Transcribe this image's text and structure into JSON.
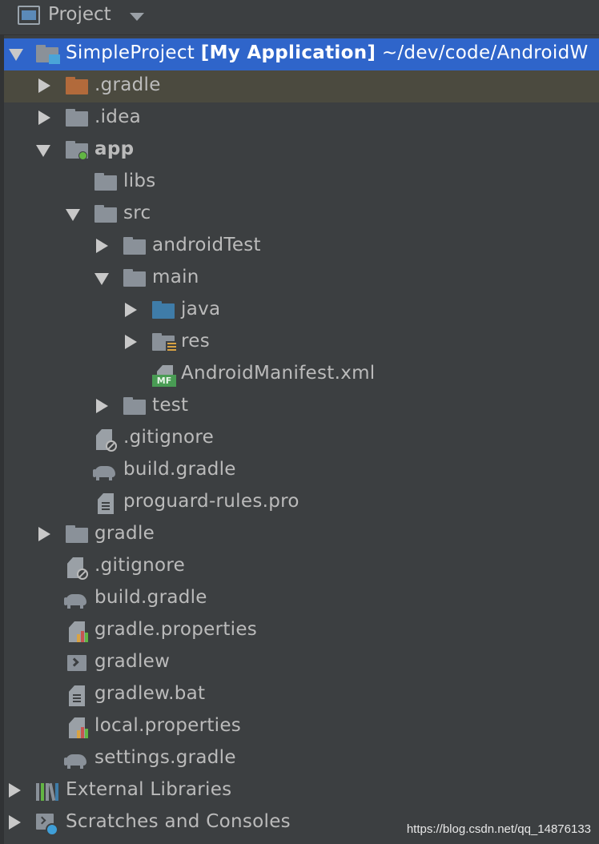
{
  "header": {
    "title": "Project"
  },
  "tree": {
    "root": {
      "name": "SimpleProject",
      "module": "[My Application]",
      "path": "~/dev/code/AndroidW"
    },
    "items": [
      ".gradle",
      ".idea",
      "app",
      "libs",
      "src",
      "androidTest",
      "main",
      "java",
      "res",
      "AndroidManifest.xml",
      "test",
      ".gitignore",
      "build.gradle",
      "proguard-rules.pro",
      "gradle",
      ".gitignore",
      "build.gradle",
      "gradle.properties",
      "gradlew",
      "gradlew.bat",
      "local.properties",
      "settings.gradle",
      "External Libraries",
      "Scratches and Consoles"
    ]
  },
  "icons": {
    "manifest_badge": "MF"
  },
  "watermark": "https://blog.csdn.net/qq_14876133",
  "colors": {
    "selection": "#2f65ca",
    "background": "#3c3f41",
    "folder": "#8a9199",
    "gradle_folder": "#b26a3b",
    "source_folder": "#3f7ca8"
  }
}
